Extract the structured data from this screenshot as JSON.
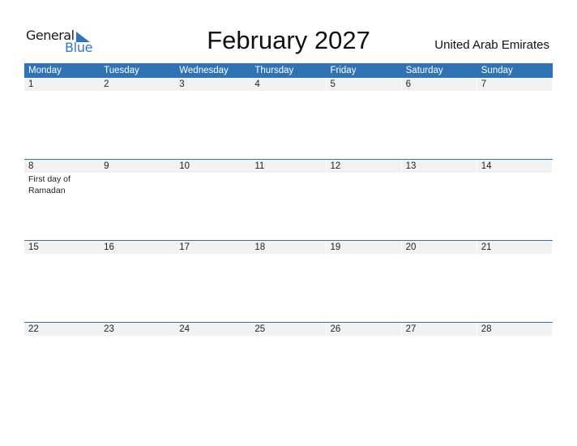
{
  "logo": {
    "general": "General",
    "blue": "Blue"
  },
  "title": "February 2027",
  "country": "United Arab Emirates",
  "colors": {
    "accent": "#2f73b5",
    "date_strip": "#f1f1f1"
  },
  "weekdays": [
    "Monday",
    "Tuesday",
    "Wednesday",
    "Thursday",
    "Friday",
    "Saturday",
    "Sunday"
  ],
  "weeks": [
    {
      "days": [
        {
          "num": "1",
          "event": ""
        },
        {
          "num": "2",
          "event": ""
        },
        {
          "num": "3",
          "event": ""
        },
        {
          "num": "4",
          "event": ""
        },
        {
          "num": "5",
          "event": ""
        },
        {
          "num": "6",
          "event": ""
        },
        {
          "num": "7",
          "event": ""
        }
      ]
    },
    {
      "days": [
        {
          "num": "8",
          "event": "First day of Ramadan"
        },
        {
          "num": "9",
          "event": ""
        },
        {
          "num": "10",
          "event": ""
        },
        {
          "num": "11",
          "event": ""
        },
        {
          "num": "12",
          "event": ""
        },
        {
          "num": "13",
          "event": ""
        },
        {
          "num": "14",
          "event": ""
        }
      ]
    },
    {
      "days": [
        {
          "num": "15",
          "event": ""
        },
        {
          "num": "16",
          "event": ""
        },
        {
          "num": "17",
          "event": ""
        },
        {
          "num": "18",
          "event": ""
        },
        {
          "num": "19",
          "event": ""
        },
        {
          "num": "20",
          "event": ""
        },
        {
          "num": "21",
          "event": ""
        }
      ]
    },
    {
      "days": [
        {
          "num": "22",
          "event": ""
        },
        {
          "num": "23",
          "event": ""
        },
        {
          "num": "24",
          "event": ""
        },
        {
          "num": "25",
          "event": ""
        },
        {
          "num": "26",
          "event": ""
        },
        {
          "num": "27",
          "event": ""
        },
        {
          "num": "28",
          "event": ""
        }
      ]
    }
  ]
}
